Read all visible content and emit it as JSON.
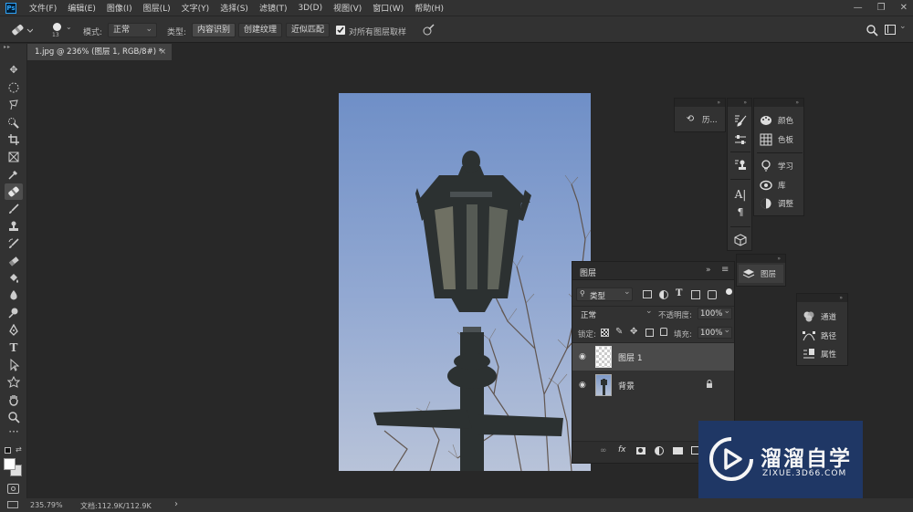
{
  "menubar": {
    "logo": "Ps",
    "items": [
      "文件(F)",
      "编辑(E)",
      "图像(I)",
      "图层(L)",
      "文字(Y)",
      "选择(S)",
      "滤镜(T)",
      "3D(D)",
      "视图(V)",
      "窗口(W)",
      "帮助(H)"
    ],
    "window_controls": [
      "—",
      "❐",
      "✕"
    ]
  },
  "options": {
    "brush_size": "13",
    "mode_label": "模式:",
    "mode_value": "正常",
    "type_label": "类型:",
    "type_buttons": [
      "内容识别",
      "创建纹理",
      "近似匹配"
    ],
    "sample_all_label": "对所有图层取样",
    "sample_all_checked": true
  },
  "document": {
    "tab_title": "1.jpg @ 236% (图层 1, RGB/8#) *",
    "close": "×"
  },
  "status": {
    "zoom": "235.79%",
    "doc_info": "文档:112.9K/112.9K",
    "arrow": "›"
  },
  "panels": {
    "history": {
      "label": "历..."
    },
    "dock_right": [
      {
        "icon": "palette-icon",
        "label": "颜色"
      },
      {
        "icon": "grid-icon",
        "label": "色板"
      },
      {
        "icon": "bulb-icon",
        "label": "学习"
      },
      {
        "icon": "cc-library-icon",
        "label": "库"
      },
      {
        "icon": "adjust-icon",
        "label": "调整"
      }
    ],
    "layers_mini": {
      "label": "图层"
    },
    "channels_group": [
      {
        "icon": "channels-icon",
        "label": "通道"
      },
      {
        "icon": "paths-icon",
        "label": "路径"
      },
      {
        "icon": "properties-icon",
        "label": "属性"
      }
    ]
  },
  "layers_panel": {
    "title": "图层",
    "filter_value": "类型",
    "blend_mode": "正常",
    "opacity_label": "不透明度:",
    "opacity_value": "100%",
    "lock_label": "锁定:",
    "fill_label": "填充:",
    "fill_value": "100%",
    "layers": [
      {
        "name": "图层 1",
        "selected": true,
        "locked": false
      },
      {
        "name": "背景",
        "selected": false,
        "locked": true
      }
    ],
    "footer_icons": [
      "link-icon",
      "fx-icon",
      "mask-icon",
      "adjustment-icon",
      "folder-icon",
      "new-layer-icon"
    ],
    "footer_fx": "fx"
  },
  "watermark": {
    "brand": "溜溜自学",
    "url": "ZIXUE.3D66.COM"
  },
  "colors": {
    "accent": "#2fa3f7",
    "panel": "#323232",
    "canvas_bg": "#282828",
    "sky": "#8fa7cf"
  }
}
